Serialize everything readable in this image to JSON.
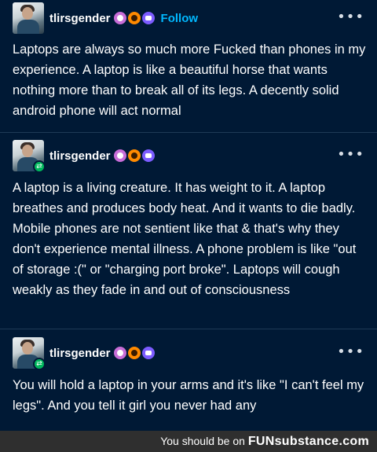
{
  "posts": [
    {
      "username": "tlirsgender",
      "follow_label": "Follow",
      "menu_icon": "more-icon",
      "text": "Laptops are always so much more Fucked than phones in my experience. A laptop is like a beautiful horse that wants nothing more than to break all of its legs. A decently solid android phone will act normal"
    },
    {
      "username": "tlirsgender",
      "menu_icon": "more-icon",
      "text": "A laptop is a living creature. It has weight to it. A laptop breathes and produces body heat. And it wants to die badly. Mobile phones are not sentient like that & that's why they don't experience mental illness. A phone problem is like \"out of storage :(\" or \"charging port broke\". Laptops will cough weakly as they fade in and out of consciousness"
    },
    {
      "username": "tlirsgender",
      "menu_icon": "more-icon",
      "text": "You will hold a laptop in your arms and it's like \"I can't feel my legs\". And you tell it girl you never had any"
    }
  ],
  "footer": {
    "prefix": "You should be on",
    "brand_a": "FUN",
    "brand_b": "substance",
    "brand_c": ".com"
  },
  "colors": {
    "background": "#001935",
    "follow": "#00b8ff",
    "reblog": "#00b85c"
  }
}
